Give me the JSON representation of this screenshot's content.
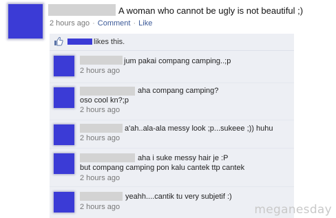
{
  "post": {
    "text": "A woman who cannot be ugly is not beautiful ;)",
    "time": "2 hours ago",
    "comment_link": "Comment",
    "like_link": "Like"
  },
  "likes": {
    "text": "likes this."
  },
  "comments": [
    {
      "line1": "jum pakai compang camping..;p",
      "time": "2 hours ago"
    },
    {
      "line1": "aha compang camping?",
      "line2": "oso cool kn?;p",
      "time": "2 hours ago"
    },
    {
      "line1": "a'ah..ala-ala messy look ;p...sukeee ;)) huhu",
      "time": "2 hours ago"
    },
    {
      "line1": "aha i suke messy hair je :P",
      "line2": "but compang camping pon kalu cantek ttp cantek",
      "time": "2 hours ago"
    },
    {
      "line1": "yeahh....cantik tu very subjetif :)",
      "time": "2 hours ago"
    }
  ],
  "watermark": "meganesday",
  "colors": {
    "link": "#3b5998",
    "panel": "#edeff4",
    "avatar": "#3b3bd6",
    "redaction": "#d3d3d3"
  },
  "icons": {
    "like": "thumbs-up-icon"
  }
}
